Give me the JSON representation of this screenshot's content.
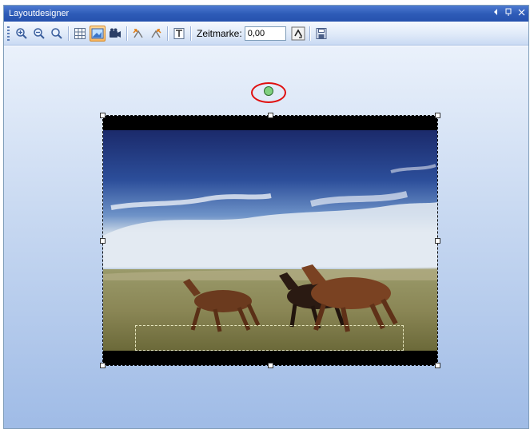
{
  "window": {
    "title": "Layoutdesigner",
    "controls": {
      "pin": "⊣",
      "float": "ᴨ",
      "close": "×"
    }
  },
  "toolbar": {
    "buttons": [
      {
        "icon": "zoom-in-icon"
      },
      {
        "icon": "zoom-out-icon"
      },
      {
        "icon": "zoom-fit-icon"
      },
      {
        "icon": "grid-icon"
      },
      {
        "icon": "image-mode-icon",
        "active": true
      },
      {
        "icon": "camera-icon"
      },
      {
        "icon": "move-left-icon"
      },
      {
        "icon": "move-right-icon"
      },
      {
        "icon": "text-icon"
      }
    ],
    "timestamp_label": "Zeitmarke:",
    "timestamp_value": "0,00",
    "spin_icon": "spin-icon",
    "save_icon": "save-icon"
  },
  "canvas": {
    "image": "horses-running-photo"
  },
  "colors": {
    "accent": "#2e5cb8",
    "rotation_ring": "#e01010",
    "rotation_handle": "#7fd07f"
  }
}
